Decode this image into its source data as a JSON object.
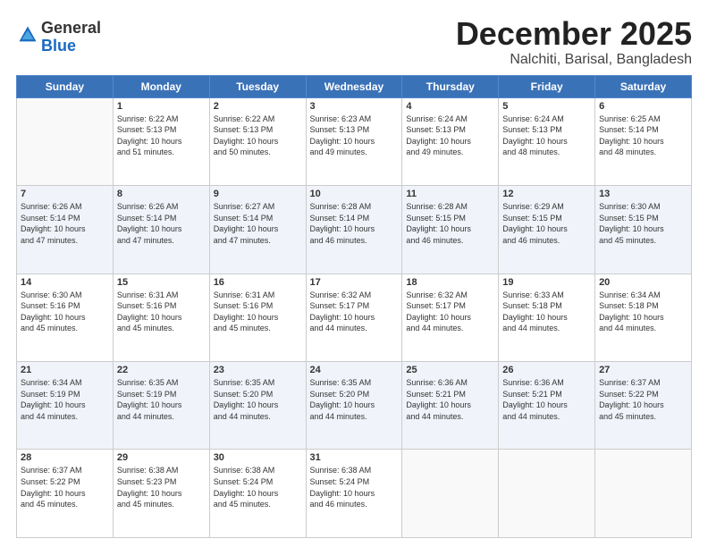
{
  "logo": {
    "general": "General",
    "blue": "Blue"
  },
  "header": {
    "month": "December 2025",
    "location": "Nalchiti, Barisal, Bangladesh"
  },
  "weekdays": [
    "Sunday",
    "Monday",
    "Tuesday",
    "Wednesday",
    "Thursday",
    "Friday",
    "Saturday"
  ],
  "weeks": [
    [
      {
        "day": "",
        "content": ""
      },
      {
        "day": "1",
        "content": "Sunrise: 6:22 AM\nSunset: 5:13 PM\nDaylight: 10 hours\nand 51 minutes."
      },
      {
        "day": "2",
        "content": "Sunrise: 6:22 AM\nSunset: 5:13 PM\nDaylight: 10 hours\nand 50 minutes."
      },
      {
        "day": "3",
        "content": "Sunrise: 6:23 AM\nSunset: 5:13 PM\nDaylight: 10 hours\nand 49 minutes."
      },
      {
        "day": "4",
        "content": "Sunrise: 6:24 AM\nSunset: 5:13 PM\nDaylight: 10 hours\nand 49 minutes."
      },
      {
        "day": "5",
        "content": "Sunrise: 6:24 AM\nSunset: 5:13 PM\nDaylight: 10 hours\nand 48 minutes."
      },
      {
        "day": "6",
        "content": "Sunrise: 6:25 AM\nSunset: 5:14 PM\nDaylight: 10 hours\nand 48 minutes."
      }
    ],
    [
      {
        "day": "7",
        "content": "Sunrise: 6:26 AM\nSunset: 5:14 PM\nDaylight: 10 hours\nand 47 minutes."
      },
      {
        "day": "8",
        "content": "Sunrise: 6:26 AM\nSunset: 5:14 PM\nDaylight: 10 hours\nand 47 minutes."
      },
      {
        "day": "9",
        "content": "Sunrise: 6:27 AM\nSunset: 5:14 PM\nDaylight: 10 hours\nand 47 minutes."
      },
      {
        "day": "10",
        "content": "Sunrise: 6:28 AM\nSunset: 5:14 PM\nDaylight: 10 hours\nand 46 minutes."
      },
      {
        "day": "11",
        "content": "Sunrise: 6:28 AM\nSunset: 5:15 PM\nDaylight: 10 hours\nand 46 minutes."
      },
      {
        "day": "12",
        "content": "Sunrise: 6:29 AM\nSunset: 5:15 PM\nDaylight: 10 hours\nand 46 minutes."
      },
      {
        "day": "13",
        "content": "Sunrise: 6:30 AM\nSunset: 5:15 PM\nDaylight: 10 hours\nand 45 minutes."
      }
    ],
    [
      {
        "day": "14",
        "content": "Sunrise: 6:30 AM\nSunset: 5:16 PM\nDaylight: 10 hours\nand 45 minutes."
      },
      {
        "day": "15",
        "content": "Sunrise: 6:31 AM\nSunset: 5:16 PM\nDaylight: 10 hours\nand 45 minutes."
      },
      {
        "day": "16",
        "content": "Sunrise: 6:31 AM\nSunset: 5:16 PM\nDaylight: 10 hours\nand 45 minutes."
      },
      {
        "day": "17",
        "content": "Sunrise: 6:32 AM\nSunset: 5:17 PM\nDaylight: 10 hours\nand 44 minutes."
      },
      {
        "day": "18",
        "content": "Sunrise: 6:32 AM\nSunset: 5:17 PM\nDaylight: 10 hours\nand 44 minutes."
      },
      {
        "day": "19",
        "content": "Sunrise: 6:33 AM\nSunset: 5:18 PM\nDaylight: 10 hours\nand 44 minutes."
      },
      {
        "day": "20",
        "content": "Sunrise: 6:34 AM\nSunset: 5:18 PM\nDaylight: 10 hours\nand 44 minutes."
      }
    ],
    [
      {
        "day": "21",
        "content": "Sunrise: 6:34 AM\nSunset: 5:19 PM\nDaylight: 10 hours\nand 44 minutes."
      },
      {
        "day": "22",
        "content": "Sunrise: 6:35 AM\nSunset: 5:19 PM\nDaylight: 10 hours\nand 44 minutes."
      },
      {
        "day": "23",
        "content": "Sunrise: 6:35 AM\nSunset: 5:20 PM\nDaylight: 10 hours\nand 44 minutes."
      },
      {
        "day": "24",
        "content": "Sunrise: 6:35 AM\nSunset: 5:20 PM\nDaylight: 10 hours\nand 44 minutes."
      },
      {
        "day": "25",
        "content": "Sunrise: 6:36 AM\nSunset: 5:21 PM\nDaylight: 10 hours\nand 44 minutes."
      },
      {
        "day": "26",
        "content": "Sunrise: 6:36 AM\nSunset: 5:21 PM\nDaylight: 10 hours\nand 44 minutes."
      },
      {
        "day": "27",
        "content": "Sunrise: 6:37 AM\nSunset: 5:22 PM\nDaylight: 10 hours\nand 45 minutes."
      }
    ],
    [
      {
        "day": "28",
        "content": "Sunrise: 6:37 AM\nSunset: 5:22 PM\nDaylight: 10 hours\nand 45 minutes."
      },
      {
        "day": "29",
        "content": "Sunrise: 6:38 AM\nSunset: 5:23 PM\nDaylight: 10 hours\nand 45 minutes."
      },
      {
        "day": "30",
        "content": "Sunrise: 6:38 AM\nSunset: 5:24 PM\nDaylight: 10 hours\nand 45 minutes."
      },
      {
        "day": "31",
        "content": "Sunrise: 6:38 AM\nSunset: 5:24 PM\nDaylight: 10 hours\nand 46 minutes."
      },
      {
        "day": "",
        "content": ""
      },
      {
        "day": "",
        "content": ""
      },
      {
        "day": "",
        "content": ""
      }
    ]
  ]
}
